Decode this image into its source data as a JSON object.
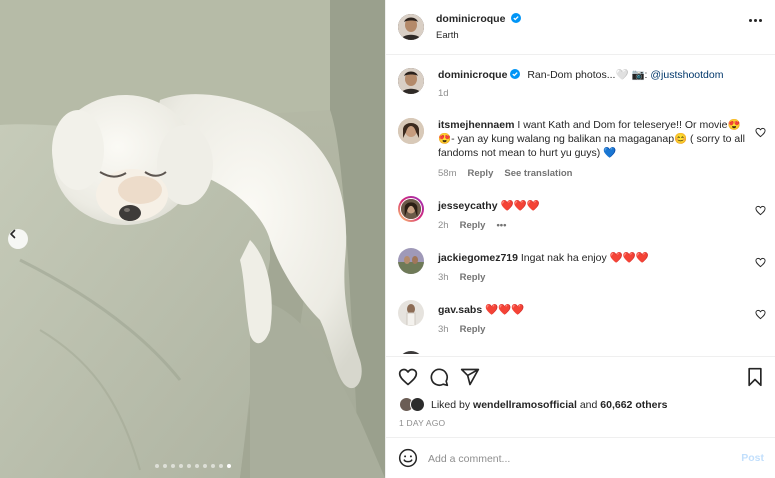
{
  "post": {
    "author": "dominicroque",
    "location": "Earth",
    "verified": true,
    "caption_text": "Ran-Dom photos...🤍 📷: ",
    "caption_mention": "@justshootdom",
    "caption_age": "1d"
  },
  "carousel": {
    "total_slides": 10,
    "active_slide": 10,
    "prev_icon": "chevron-left-icon"
  },
  "comments": [
    {
      "username": "itsmejhennaem",
      "text": "I want Kath and Dom for teleserye!! Or movie😍😍- yan ay kung walang ng balikan na magaganap😊 ( sorry to all fandoms not mean to hurt yu guys) 💙",
      "age": "58m",
      "reply_label": "Reply",
      "translate_label": "See translation"
    },
    {
      "username": "jesseycathy",
      "text": "❤️❤️❤️",
      "age": "2h",
      "reply_label": "Reply",
      "more_label": "•••"
    },
    {
      "username": "jackiegomez719",
      "text": "Ingat nak ha enjoy ❤️❤️❤️",
      "age": "3h",
      "reply_label": "Reply"
    },
    {
      "username": "gav.sabs",
      "text": "❤️❤️❤️",
      "age": "3h",
      "reply_label": "Reply"
    }
  ],
  "likes": {
    "prefix": "Liked by ",
    "liker": "wendellramosofficial",
    "middle": " and ",
    "others": "60,662 others"
  },
  "posted_ago": "1 DAY AGO",
  "composer": {
    "placeholder": "Add a comment...",
    "post_label": "Post",
    "emoji_icon": "emoji-icon"
  },
  "icons": {
    "like": "heart-icon",
    "comment": "comment-icon",
    "share": "share-icon",
    "save": "bookmark-icon",
    "verified": "verified-badge-icon"
  },
  "colors": {
    "verified": "#0095f6",
    "link": "#00376b",
    "post_disabled": "#c2dffc",
    "meta": "#8e8e8e"
  }
}
